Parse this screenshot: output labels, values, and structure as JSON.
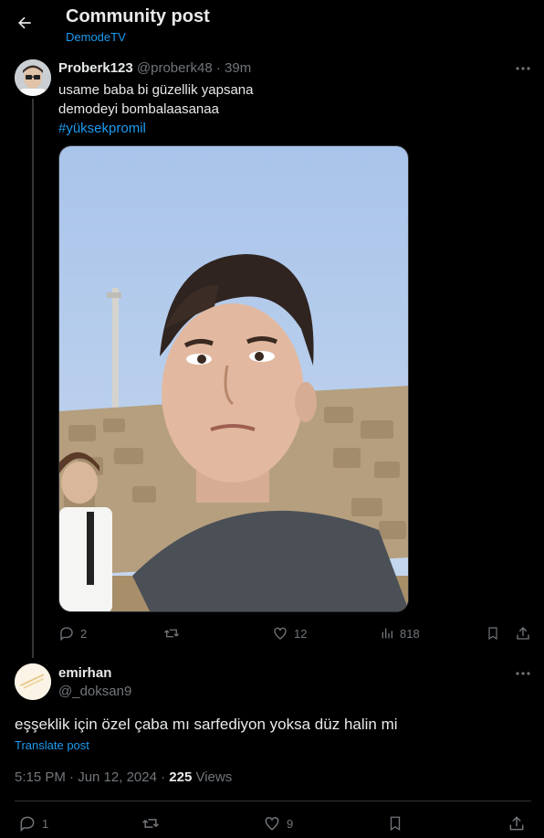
{
  "header": {
    "title": "Community post",
    "community": "DemodeTV"
  },
  "post": {
    "display_name": "Proberk123",
    "handle": "@proberk48",
    "separator": "·",
    "time": "39m",
    "text_line1": "usame baba bi güzellik yapsana",
    "text_line2": "demodeyi bombalaasanaa",
    "hashtag": "#yüksekpromil",
    "media_icon": "photo-of-young-man-outdoors",
    "stats": {
      "replies": "2",
      "reposts": "",
      "likes": "12",
      "views": "818"
    }
  },
  "reply": {
    "display_name": "emirhan",
    "handle": "@_doksan9",
    "text": "eşşeklik için özel çaba mı sarfediyon yoksa düz halin mi",
    "translate_label": "Translate post",
    "timestamp": "5:15 PM · Jun 12, 2024 · ",
    "views_count": "225",
    "views_label": " Views",
    "stats": {
      "replies": "1",
      "reposts": "",
      "likes": "9"
    }
  },
  "colors": {
    "background": "#000000",
    "text": "#e7e9ea",
    "muted": "#71767b",
    "accent": "#1d9bf0",
    "border": "#2f3336"
  }
}
